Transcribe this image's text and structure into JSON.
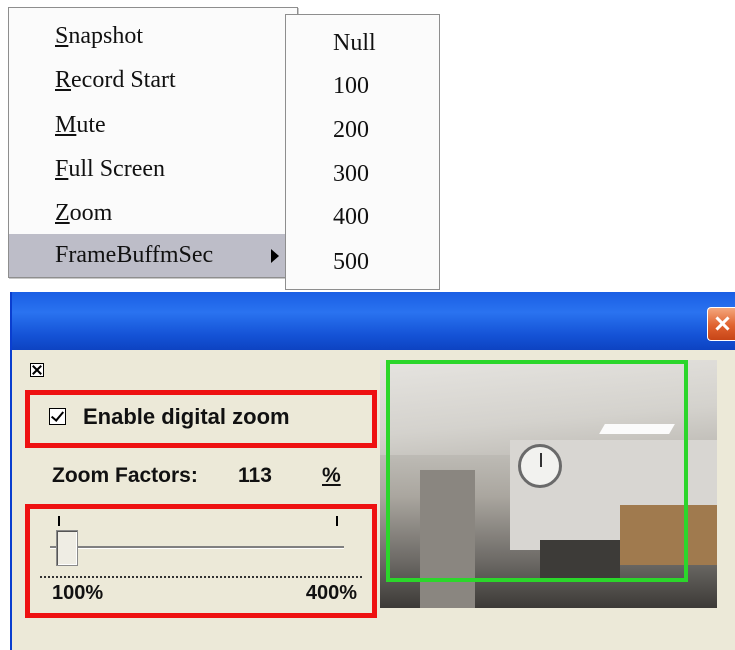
{
  "context_menu": {
    "items": [
      {
        "accel": "S",
        "rest": "napshot"
      },
      {
        "accel": "R",
        "rest": "ecord Start"
      },
      {
        "accel": "M",
        "rest": "ute"
      },
      {
        "accel": "F",
        "rest": "ull Screen"
      },
      {
        "accel": "Z",
        "rest": "oom"
      },
      {
        "label": "FrameBuffmSec"
      }
    ]
  },
  "submenu": {
    "items": [
      "Null",
      "100",
      "200",
      "300",
      "400",
      "500"
    ]
  },
  "dialog": {
    "enable_label": "Enable digital zoom",
    "enable_checked": true,
    "zoom_factors_label": "Zoom Factors:",
    "zoom_value": "113",
    "zoom_unit": "%",
    "slider": {
      "min_label": "100%",
      "max_label": "400%",
      "min": 100,
      "max": 400,
      "value": 113
    },
    "colors": {
      "highlight": "#ee1111",
      "zoom_region": "#2bd62b",
      "titlebar": "#1a5ee4"
    }
  }
}
